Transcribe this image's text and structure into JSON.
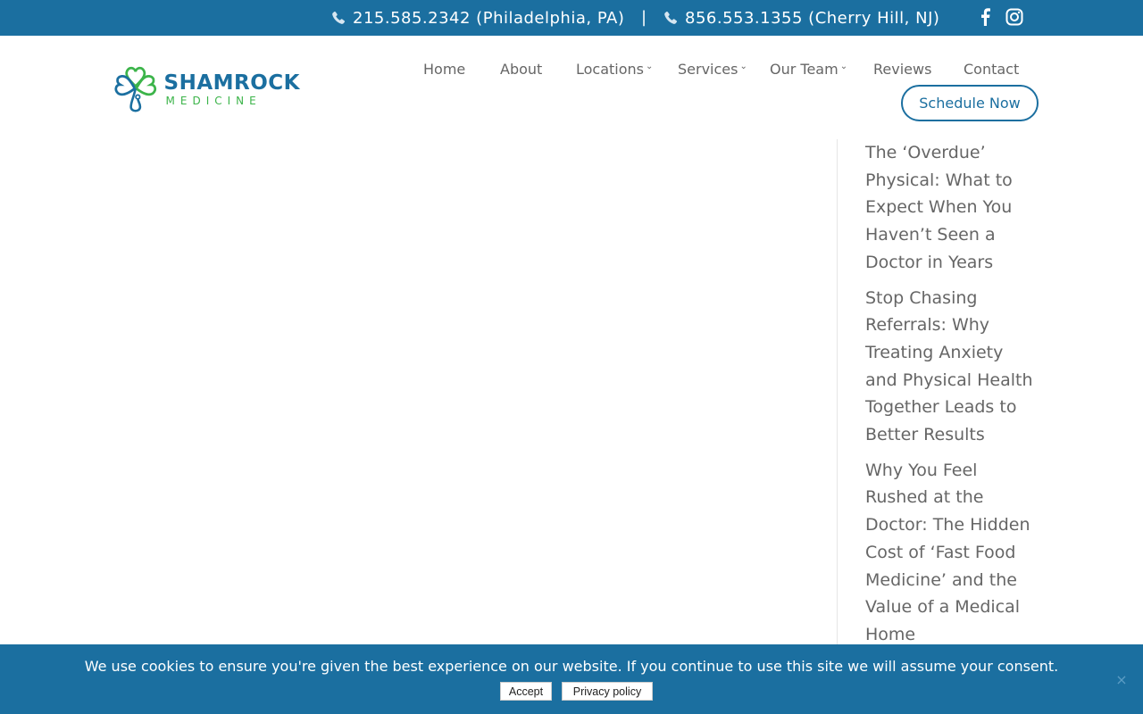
{
  "topbar": {
    "phone1": "215.585.2342 (Philadelphia, PA)",
    "separator": "|",
    "phone2": "856.553.1355 (Cherry Hill, NJ)",
    "icons": [
      "phone-icon",
      "facebook-icon",
      "instagram-icon"
    ]
  },
  "brand": {
    "name": "SHAMROCK",
    "sub": "MEDICINE",
    "colors": {
      "blue": "#1b6fa0",
      "green": "#3cb44a"
    }
  },
  "nav": {
    "items": [
      {
        "label": "Home"
      },
      {
        "label": "About"
      },
      {
        "label": "Locations",
        "dropdown": true
      },
      {
        "label": "Services",
        "dropdown": true
      },
      {
        "label": "Our Team",
        "dropdown": true
      },
      {
        "label": "Reviews"
      },
      {
        "label": "Contact"
      }
    ],
    "cta": "Schedule Now"
  },
  "sidebar": {
    "posts": [
      "The ‘Overdue’ Physical: What to Expect When You Haven’t Seen a Doctor in Years",
      "Stop Chasing Referrals: Why Treating Anxiety and Physical Health Together Leads to Better Results",
      "Why You Feel Rushed at the Doctor: The Hidden Cost of ‘Fast Food Medicine’ and the Value of a Medical Home"
    ]
  },
  "cookie": {
    "message": "We use cookies to ensure you're given the best experience on our website. If you continue to use this site we will assume your consent.",
    "accept": "Accept",
    "privacy": "Privacy policy",
    "close": "×"
  }
}
